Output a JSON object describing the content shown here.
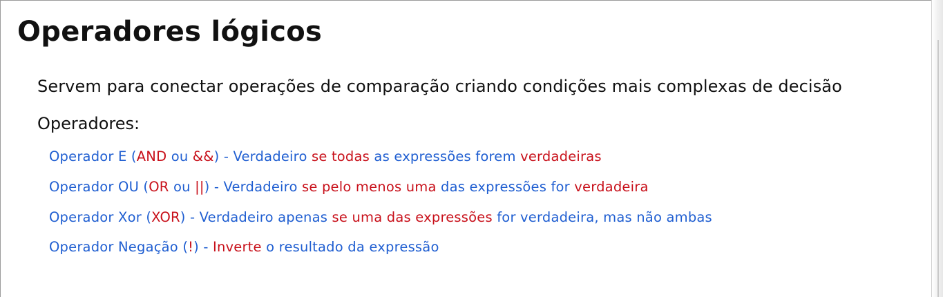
{
  "title": "Operadores lógicos",
  "description": "Servem para conectar operações de comparação criando condições mais complexas de decisão",
  "operators_label": "Operadores:",
  "operators": [
    {
      "segments": [
        {
          "text": "Operador E (",
          "color": "blue"
        },
        {
          "text": "AND",
          "color": "red"
        },
        {
          "text": " ou ",
          "color": "blue"
        },
        {
          "text": "&&",
          "color": "red"
        },
        {
          "text": ") - Verdadeiro ",
          "color": "blue"
        },
        {
          "text": "se todas",
          "color": "red"
        },
        {
          "text": " as expressões forem ",
          "color": "blue"
        },
        {
          "text": "verdadeiras",
          "color": "red"
        }
      ]
    },
    {
      "segments": [
        {
          "text": "Operador OU (",
          "color": "blue"
        },
        {
          "text": "OR",
          "color": "red"
        },
        {
          "text": " ou ",
          "color": "blue"
        },
        {
          "text": "||",
          "color": "red"
        },
        {
          "text": ") - Verdadeiro ",
          "color": "blue"
        },
        {
          "text": "se pelo menos uma",
          "color": "red"
        },
        {
          "text": " das expressões for ",
          "color": "blue"
        },
        {
          "text": "verdadeira",
          "color": "red"
        }
      ]
    },
    {
      "segments": [
        {
          "text": "Operador Xor (",
          "color": "blue"
        },
        {
          "text": "XOR",
          "color": "red"
        },
        {
          "text": ") - Verdadeiro apenas ",
          "color": "blue"
        },
        {
          "text": "se uma das expressões",
          "color": "red"
        },
        {
          "text": " for verdadeira, mas não ambas",
          "color": "blue"
        }
      ]
    },
    {
      "segments": [
        {
          "text": "Operador Negação (",
          "color": "blue"
        },
        {
          "text": "!",
          "color": "red"
        },
        {
          "text": ") - ",
          "color": "blue"
        },
        {
          "text": "Inverte",
          "color": "red"
        },
        {
          "text": " o resultado da expressão",
          "color": "blue"
        }
      ]
    }
  ],
  "colors": {
    "blue": "#1f5ed1",
    "red": "#c8101a",
    "text": "#111111"
  }
}
